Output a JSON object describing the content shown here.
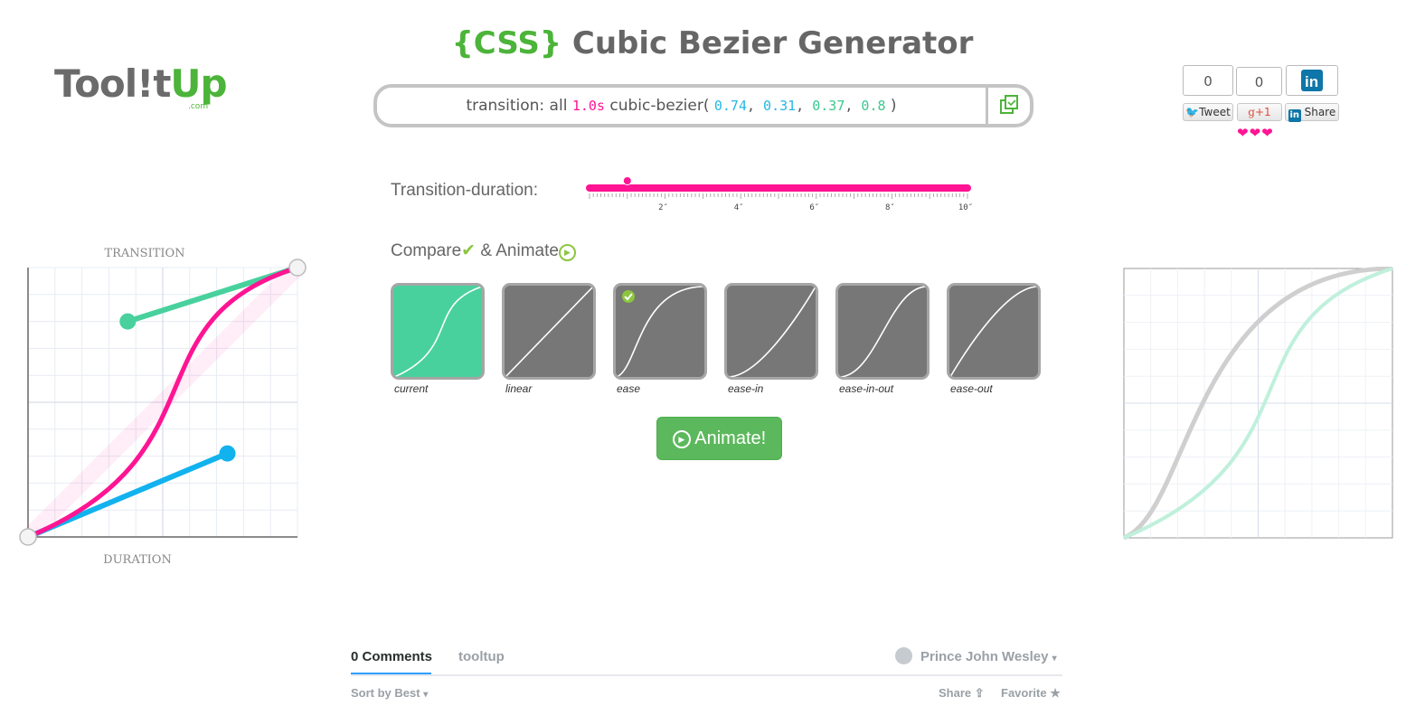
{
  "logo": {
    "part1": "Tool!t",
    "part2": "Up",
    "suffix": ".com"
  },
  "title": {
    "prefix": "{CSS}",
    "text": " Cubic Bezier Generator"
  },
  "code": {
    "lead": "transition: all ",
    "duration": "1.0s",
    "fn": " cubic-bezier( ",
    "p1x": "0.74",
    "p1y": "0.31",
    "p2x": "0.37",
    "p2y": "0.8",
    "sep": ", ",
    "close": " )"
  },
  "bezier": {
    "p1": [
      0.74,
      0.31
    ],
    "p2": [
      0.37,
      0.8
    ]
  },
  "social": {
    "tweet_count": "0",
    "gplus_count": "0",
    "tweet_label": "Tweet",
    "gplus_label": "+1",
    "share_label": "Share",
    "li_label": "in",
    "hearts": "❤❤❤"
  },
  "editor": {
    "top_label": "TRANSITION",
    "bottom_label": "DURATION"
  },
  "duration": {
    "label": "Transition-duration:",
    "value": 1.0,
    "max": 10,
    "ticks": [
      "2″",
      "4″",
      "6″",
      "8″",
      "10″"
    ]
  },
  "compare": {
    "heading": "Compare",
    "check": "✔",
    "mid": " & Animate",
    "play": "▶",
    "presets": [
      {
        "label": "current",
        "curve": [
          0.74,
          0.31,
          0.37,
          0.8
        ],
        "selected": false
      },
      {
        "label": "linear",
        "curve": [
          0,
          0,
          1,
          1
        ],
        "selected": false
      },
      {
        "label": "ease",
        "curve": [
          0.25,
          0.1,
          0.25,
          1
        ],
        "selected": true
      },
      {
        "label": "ease-in",
        "curve": [
          0.42,
          0,
          1,
          1
        ],
        "selected": false
      },
      {
        "label": "ease-in-out",
        "curve": [
          0.42,
          0,
          0.58,
          1
        ],
        "selected": false
      },
      {
        "label": "ease-out",
        "curve": [
          0,
          0,
          0.58,
          1
        ],
        "selected": false
      }
    ]
  },
  "animate_button": {
    "label": "Animate!"
  },
  "colors": {
    "pink": "#ff1493",
    "blue": "#12b2ee",
    "green": "#48d19d",
    "ok": "#8cc63f",
    "button": "#5cb85c",
    "gray": "#777777"
  },
  "comments": {
    "count_label": "0 Comments",
    "site": "tooltup",
    "user": "Prince John Wesley",
    "sort": "Sort by Best",
    "share": "Share",
    "favorite": "Favorite"
  }
}
